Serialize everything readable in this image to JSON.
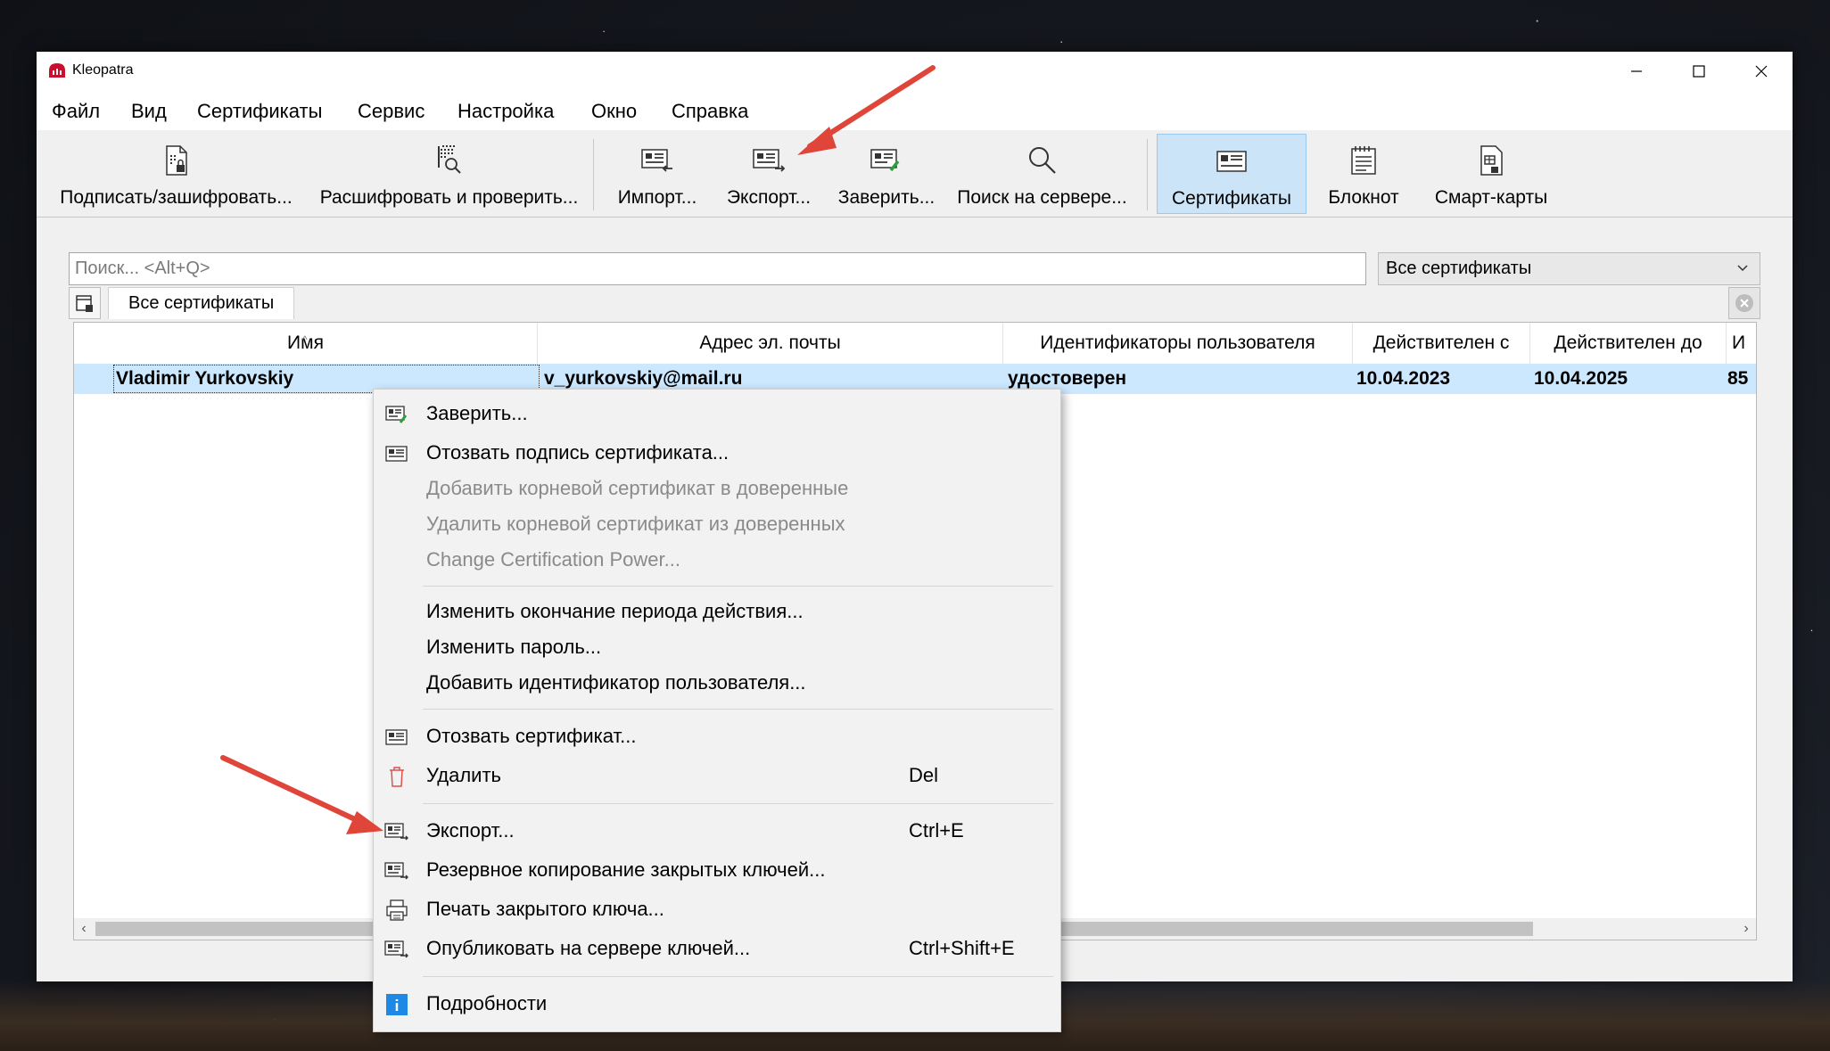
{
  "window": {
    "title": "Kleopatra",
    "controls": [
      "minimize",
      "maximize",
      "close"
    ]
  },
  "menubar": [
    "Файл",
    "Вид",
    "Сертификаты",
    "Сервис",
    "Настройка",
    "Окно",
    "Справка"
  ],
  "toolbar": {
    "sign_encrypt": "Подписать/зашифровать...",
    "decrypt_verify": "Расшифровать и проверить...",
    "import": "Импорт...",
    "export": "Экспорт...",
    "certify": "Заверить...",
    "lookup_server": "Поиск на сервере...",
    "certificates": "Сертификаты",
    "notepad": "Блокнот",
    "smartcards": "Смарт-карты"
  },
  "search": {
    "placeholder": "Поиск... <Alt+Q>",
    "value": ""
  },
  "filter": {
    "selected": "Все сертификаты"
  },
  "tabs": {
    "active": "Все сертификаты"
  },
  "table": {
    "columns": [
      "Имя",
      "Адрес эл. почты",
      "Идентификаторы пользователя",
      "Действителен с",
      "Действителен до",
      "И"
    ],
    "rows": [
      {
        "name": "Vladimir Yurkovskiy",
        "email": "v_yurkovskiy@mail.ru",
        "user_ids": "удостоверен",
        "valid_from": "10.04.2023",
        "valid_to": "10.04.2025",
        "id": "85"
      }
    ]
  },
  "context_menu": {
    "certify": "Заверить...",
    "revoke_certification": "Отозвать подпись сертификата...",
    "add_root_trusted": "Добавить корневой сертификат в доверенные",
    "remove_root_trusted": "Удалить корневой сертификат из доверенных",
    "change_cert_power": "Change Certification Power...",
    "change_expiry": "Изменить окончание периода действия...",
    "change_password": "Изменить пароль...",
    "add_user_id": "Добавить идентификатор пользователя...",
    "revoke_certificate": "Отозвать сертификат...",
    "delete": "Удалить",
    "delete_shortcut": "Del",
    "export": "Экспорт...",
    "export_shortcut": "Ctrl+E",
    "backup_secret_keys": "Резервное копирование закрытых ключей...",
    "print_secret_key": "Печать закрытого ключа...",
    "publish_keyserver": "Опубликовать на сервере ключей...",
    "publish_shortcut": "Ctrl+Shift+E",
    "details": "Подробности"
  },
  "colors": {
    "annotation_arrow": "#e0453a",
    "selection": "#cce8ff",
    "toolbar_active": "#cce4f7",
    "info_icon": "#1e88e5"
  }
}
